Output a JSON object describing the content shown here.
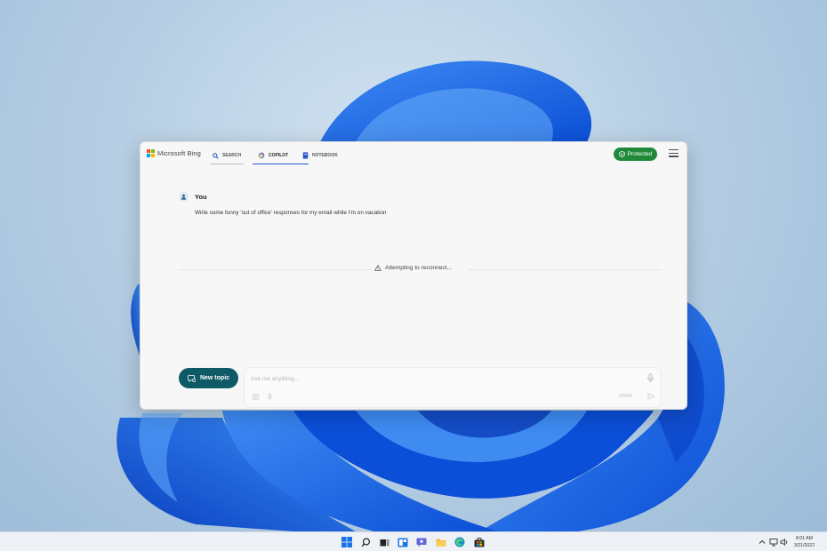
{
  "window": {
    "brand": "Microsoft Bing",
    "tabs": [
      {
        "label": "SEARCH"
      },
      {
        "label": "COPILOT"
      },
      {
        "label": "NOTEBOOK"
      }
    ],
    "protected_label": "Protected"
  },
  "conversation": {
    "user_label": "You",
    "message": "Write some funny 'out of office' responses for my email while I'm on vacation",
    "status": "Attempting to reconnect..."
  },
  "composer": {
    "new_topic_label": "New topic",
    "placeholder": "Ask me anything...",
    "counter": "0/4000"
  },
  "taskbar": {
    "time": "8:01 AM",
    "date": "3/21/2022"
  },
  "colors": {
    "copilot_underline": "#2b5ac9",
    "protected_badge": "#1f8b3a",
    "new_topic_button": "#0e5a66"
  }
}
